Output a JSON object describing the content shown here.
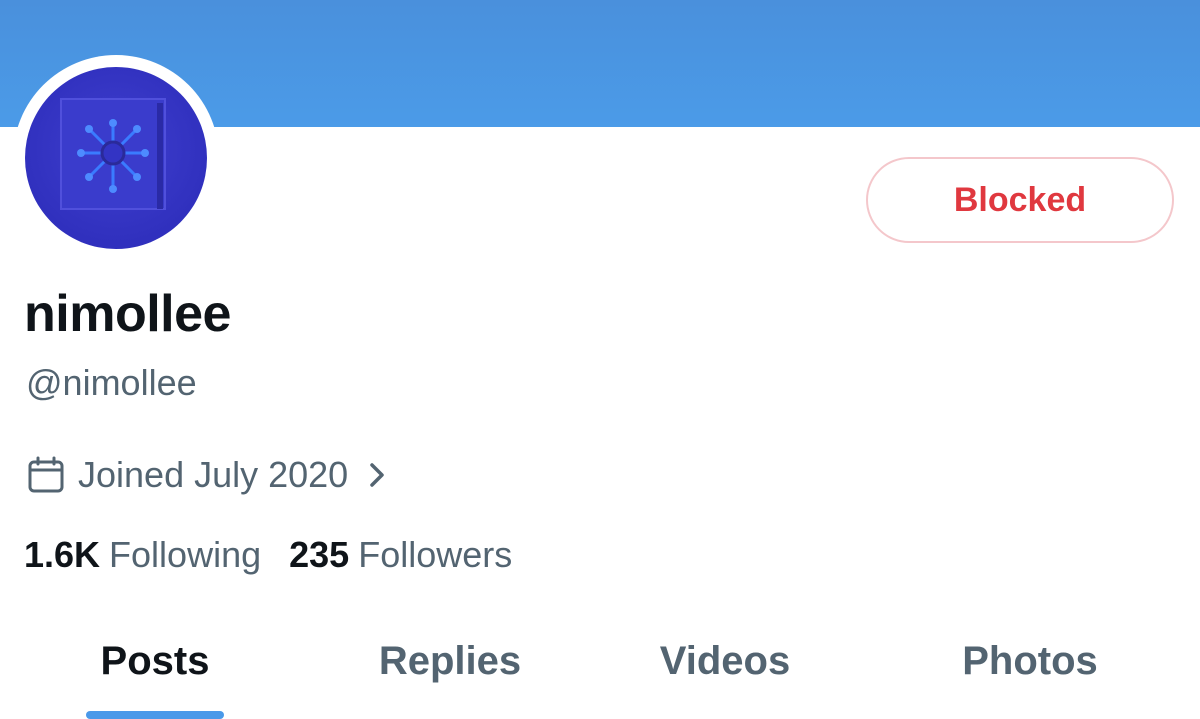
{
  "profile": {
    "display_name": "nimollee",
    "handle": "@nimollee",
    "joined": "Joined July 2020",
    "following_count": "1.6K",
    "following_label": "Following",
    "followers_count": "235",
    "followers_label": "Followers",
    "blocked_label": "Blocked"
  },
  "icons": {
    "avatar": "avatar-image",
    "calendar": "calendar-icon",
    "chevron": "chevron-right-icon"
  },
  "tabs": [
    {
      "label": "Posts",
      "active": true
    },
    {
      "label": "Replies",
      "active": false
    },
    {
      "label": "Videos",
      "active": false
    },
    {
      "label": "Photos",
      "active": false
    }
  ],
  "colors": {
    "banner": "#4a90dc",
    "blocked_text": "#e0383f",
    "blocked_border": "#f4c7cb",
    "primary_text": "#0f1419",
    "secondary_text": "#536471",
    "tab_indicator": "#4a99e9"
  }
}
